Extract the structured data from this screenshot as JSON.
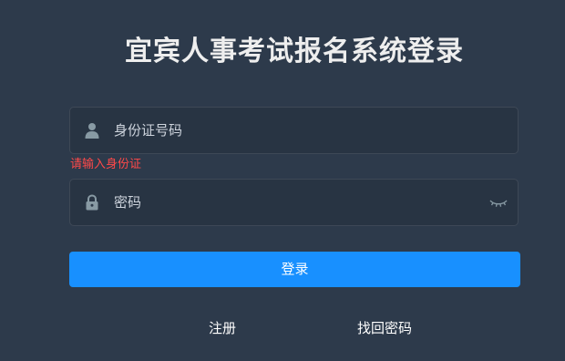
{
  "title": "宜宾人事考试报名系统登录",
  "form": {
    "id_field": {
      "placeholder": "身份证号码",
      "icon": "user-icon"
    },
    "id_error": "请输入身份证",
    "password_field": {
      "placeholder": "密码",
      "icon": "lock-icon",
      "toggle_icon": "eye-closed-icon"
    },
    "login_label": "登录"
  },
  "links": {
    "register": "注册",
    "recover_password": "找回密码"
  },
  "colors": {
    "background": "#2d3a4b",
    "primary": "#1890ff",
    "error": "#ff4949",
    "icon": "#889aa4"
  }
}
